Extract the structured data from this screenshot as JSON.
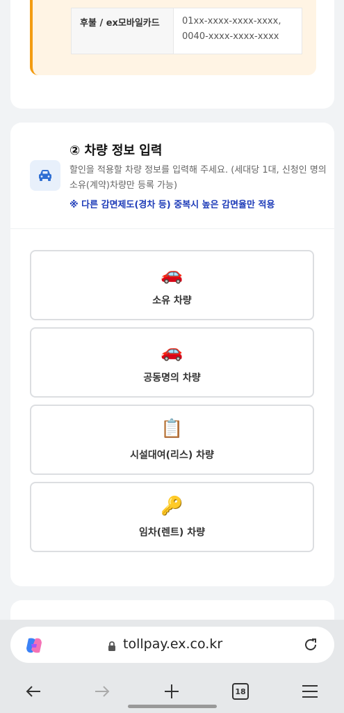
{
  "notice_table": {
    "header": "후불 / ex모바일카드",
    "value_line1": "01xx-xxxx-xxxx-xxxx,",
    "value_line2": "0040-xxxx-xxxx-xxxx"
  },
  "vehicle_section": {
    "title": "② 차량 정보 입력",
    "description": "할인을 적용할 차량 정보를 입력해 주세요. (세대당 1대, 신청인 명의 소유(계약)차량만 등록 가능)",
    "note": "※ 다른 감면제도(경차 등) 중복시 높은 감면율만 적용",
    "options": [
      {
        "label": "소유 차량",
        "emoji": "🚗"
      },
      {
        "label": "공동명의 차량",
        "emoji": "🚗"
      },
      {
        "label": "시설대여(리스) 차량",
        "emoji": "📋"
      },
      {
        "label": "임차(렌트) 차량",
        "emoji": "🔑"
      }
    ]
  },
  "browser": {
    "url": "tollpay.ex.co.kr",
    "tab_count": "18"
  },
  "icons": {
    "section": "car-icon",
    "accent_color": "#f39c12",
    "note_color": "#1d3bb8"
  }
}
